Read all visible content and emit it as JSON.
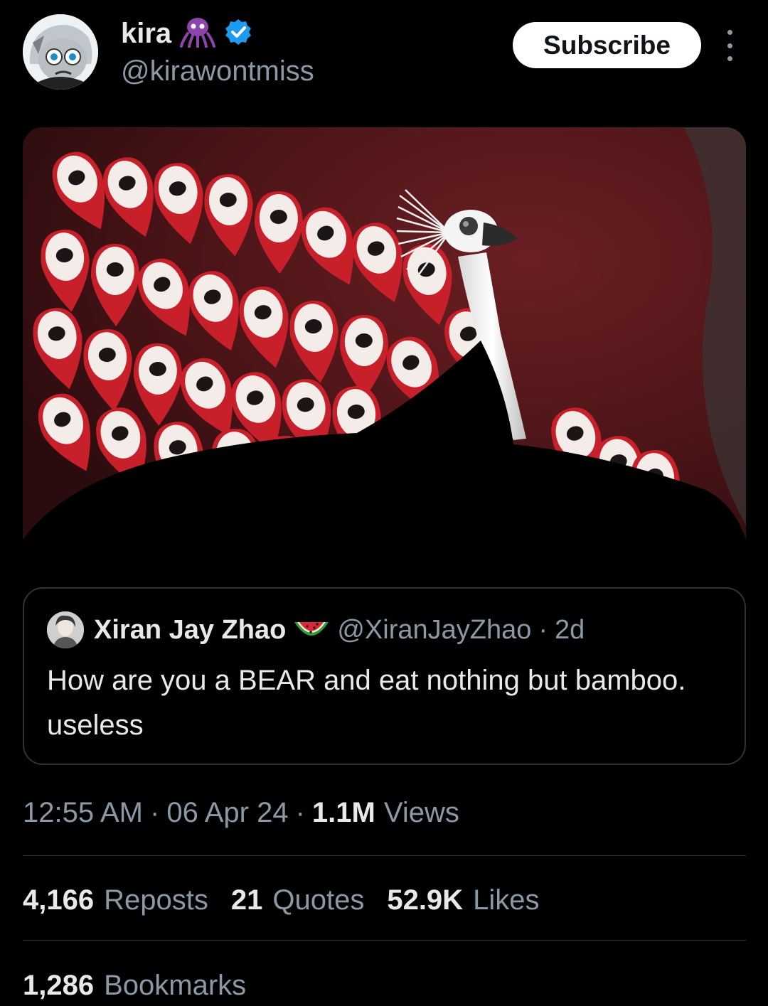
{
  "author": {
    "name": "kira",
    "handle": "@kirawontmiss",
    "name_emoji_icon": "alien-monster-icon",
    "verified_icon": "verified-badge-icon"
  },
  "header": {
    "subscribe_label": "Subscribe",
    "more_icon": "more-vertical-icon"
  },
  "quoted_post": {
    "author_name": "Xiran Jay Zhao",
    "author_emoji_icon": "watermelon-icon",
    "author_handle": "@XiranJayZhao",
    "separator": "·",
    "age": "2d",
    "text": "How are you a BEAR and eat nothing but bamboo. useless"
  },
  "meta": {
    "time": "12:55 AM",
    "separator": "·",
    "date": "06 Apr 24",
    "views_count": "1.1M",
    "views_label": "Views"
  },
  "stats": [
    {
      "count": "4,166",
      "label": "Reposts"
    },
    {
      "count": "21",
      "label": "Quotes"
    },
    {
      "count": "52.9K",
      "label": "Likes"
    }
  ],
  "bookmarks": {
    "count": "1,286",
    "label": "Bookmarks"
  },
  "colors": {
    "background": "#000000",
    "primary_text": "#e7e9ea",
    "secondary_text": "#8b98a5",
    "divider": "#2f3336",
    "verified_blue": "#1d9bf0",
    "alien_purple": "#8e44ad",
    "feather_red": "#c8202a"
  }
}
